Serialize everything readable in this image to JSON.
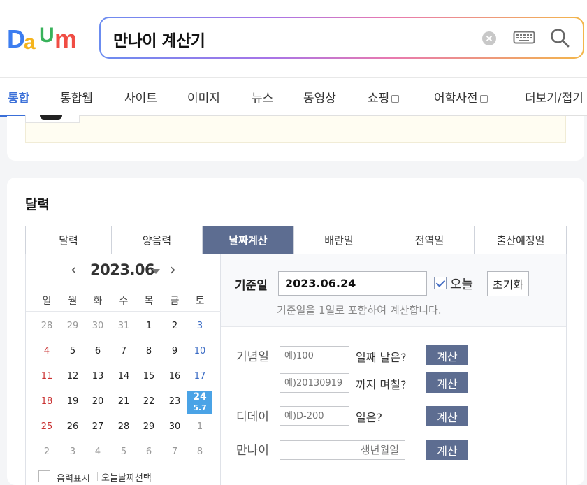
{
  "header": {
    "logo_letters": [
      "D",
      "a",
      "U",
      "m"
    ],
    "search_query": "만나이 계산기"
  },
  "tabs": [
    {
      "label": "통합",
      "active": true
    },
    {
      "label": "통합웹"
    },
    {
      "label": "사이트"
    },
    {
      "label": "이미지"
    },
    {
      "label": "뉴스"
    },
    {
      "label": "동영상"
    },
    {
      "label": "쇼핑",
      "external": true
    },
    {
      "label": "어학사전",
      "external": true
    },
    {
      "label": "더보기/접기"
    }
  ],
  "calendar_widget": {
    "title": "달력",
    "subtabs": [
      "달력",
      "양음력",
      "날짜계산",
      "배란일",
      "전역일",
      "출산예정일"
    ],
    "active_subtab": "날짜계산",
    "calendar": {
      "month_label": "2023.06",
      "weekdays": [
        "일",
        "월",
        "화",
        "수",
        "목",
        "금",
        "토"
      ],
      "weeks": [
        [
          "28",
          "29",
          "30",
          "31",
          "1",
          "2",
          "3"
        ],
        [
          "4",
          "5",
          "6",
          "7",
          "8",
          "9",
          "10"
        ],
        [
          "11",
          "12",
          "13",
          "14",
          "15",
          "16",
          "17"
        ],
        [
          "18",
          "19",
          "20",
          "21",
          "22",
          "23",
          "24"
        ],
        [
          "25",
          "26",
          "27",
          "28",
          "29",
          "30",
          "1"
        ],
        [
          "2",
          "3",
          "4",
          "5",
          "6",
          "7",
          "8"
        ]
      ],
      "today": "24",
      "today_lunar": "5.7",
      "lunar_toggle_label": "음력표시",
      "today_select_link": "오늘날짜선택"
    },
    "date_calc": {
      "base_label": "기준일",
      "base_value": "2023.06.24",
      "today_label": "오늘",
      "today_checked": true,
      "reset_label": "초기화",
      "note": "기준일을 1일로 포함하여 계산합니다.",
      "anniversary_label": "기념일",
      "anniv_days_placeholder": "예)100",
      "anniv_days_suffix": "일째 날은?",
      "anniv_date_placeholder": "예)20130919",
      "anniv_date_suffix": "까지 며칠?",
      "dday_label": "디데이",
      "dday_placeholder": "예)D-200",
      "dday_suffix": "일은?",
      "age_label": "만나이",
      "age_placeholder": "생년월일",
      "calc_label": "계산"
    }
  }
}
